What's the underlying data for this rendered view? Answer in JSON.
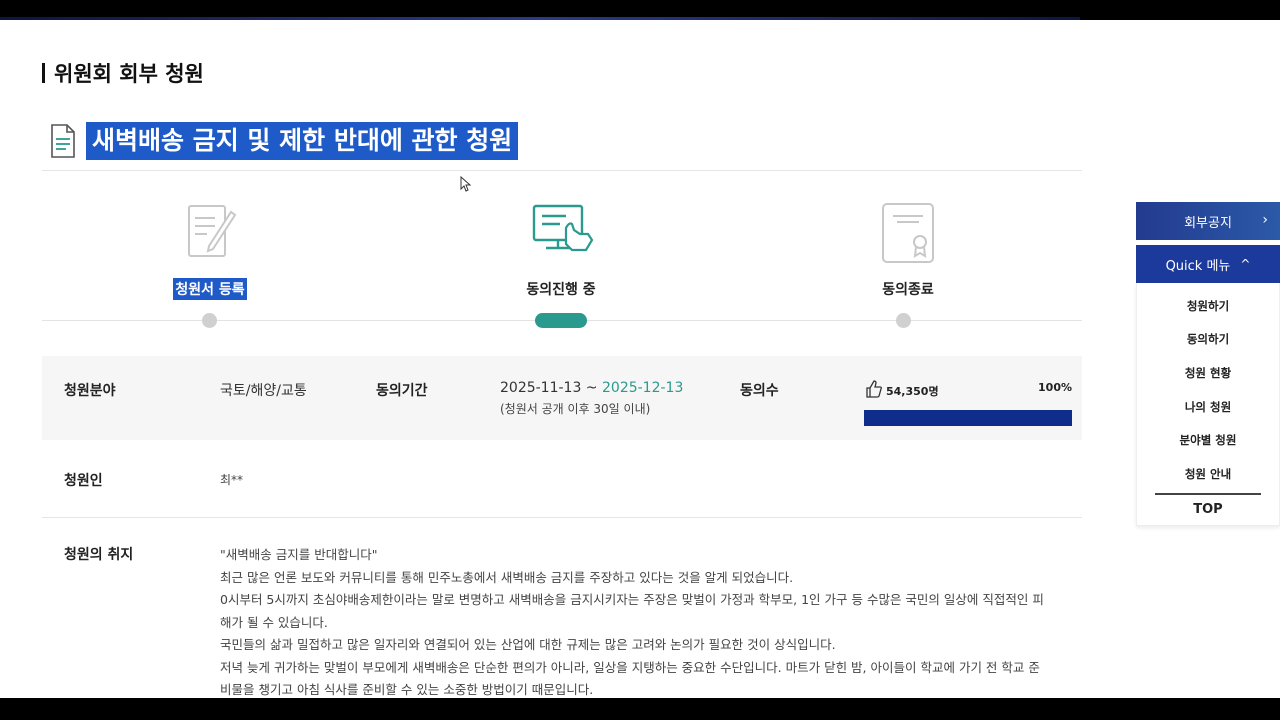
{
  "section_title": "위원회 회부 청원",
  "petition_title": "새벽배송 금지 및 제한 반대에 관한 청원",
  "steps": [
    {
      "label": "청원서 등록"
    },
    {
      "label": "동의진행 중"
    },
    {
      "label": "동의종료"
    }
  ],
  "info": {
    "field_label": "청원분야",
    "field_value": "국토/해양/교통",
    "period_label": "동의기간",
    "period_start": "2025-11-13 ~",
    "period_end": "2025-12-13",
    "period_note": "(청원서 공개 이후 30일 이내)",
    "count_label": "동의수",
    "count_value": "54,350명",
    "percent": "100%",
    "progress_fraction": 1.0
  },
  "petitioner": {
    "label": "청원인",
    "value": "최**"
  },
  "purpose": {
    "label": "청원의 취지",
    "lines": [
      "\"새벽배송 금지를 반대합니다\"",
      "최근 많은 언론 보도와 커뮤니티를 통해 민주노총에서 새벽배송 금지를 주장하고 있다는 것을 알게 되었습니다.",
      "0시부터 5시까지 초심야배송제한이라는 말로 변명하고 새벽배송을 금지시키자는 주장은 맞벌이 가정과 학부모, 1인 가구 등 수많은 국민의 일상에 직접적인 피",
      "해가 될 수 있습니다.",
      "국민들의 삶과 밀접하고 많은 일자리와 연결되어 있는 산업에 대한 규제는 많은 고려와 논의가 필요한 것이 상식입니다.",
      "저녁 늦게 귀가하는 맞벌이 부모에게 새벽배송은 단순한 편의가 아니라, 일상을 지탱하는 중요한 수단입니다. 마트가 닫힌 밤, 아이들이 학교에 가기 전 학교 준",
      "비물을 챙기고 아침 식사를 준비할 수 있는 소중한 방법이기 때문입니다."
    ]
  },
  "side": {
    "notice": "회부공지",
    "quick": "Quick 메뉴",
    "menu": [
      "청원하기",
      "동의하기",
      "청원 현황",
      "나의 청원",
      "분야별 청원",
      "청원 안내"
    ],
    "top": "TOP"
  },
  "colors": {
    "accent_teal": "#2a9a8e",
    "navy": "#0f2d8a",
    "selection": "#1f5bc8"
  }
}
